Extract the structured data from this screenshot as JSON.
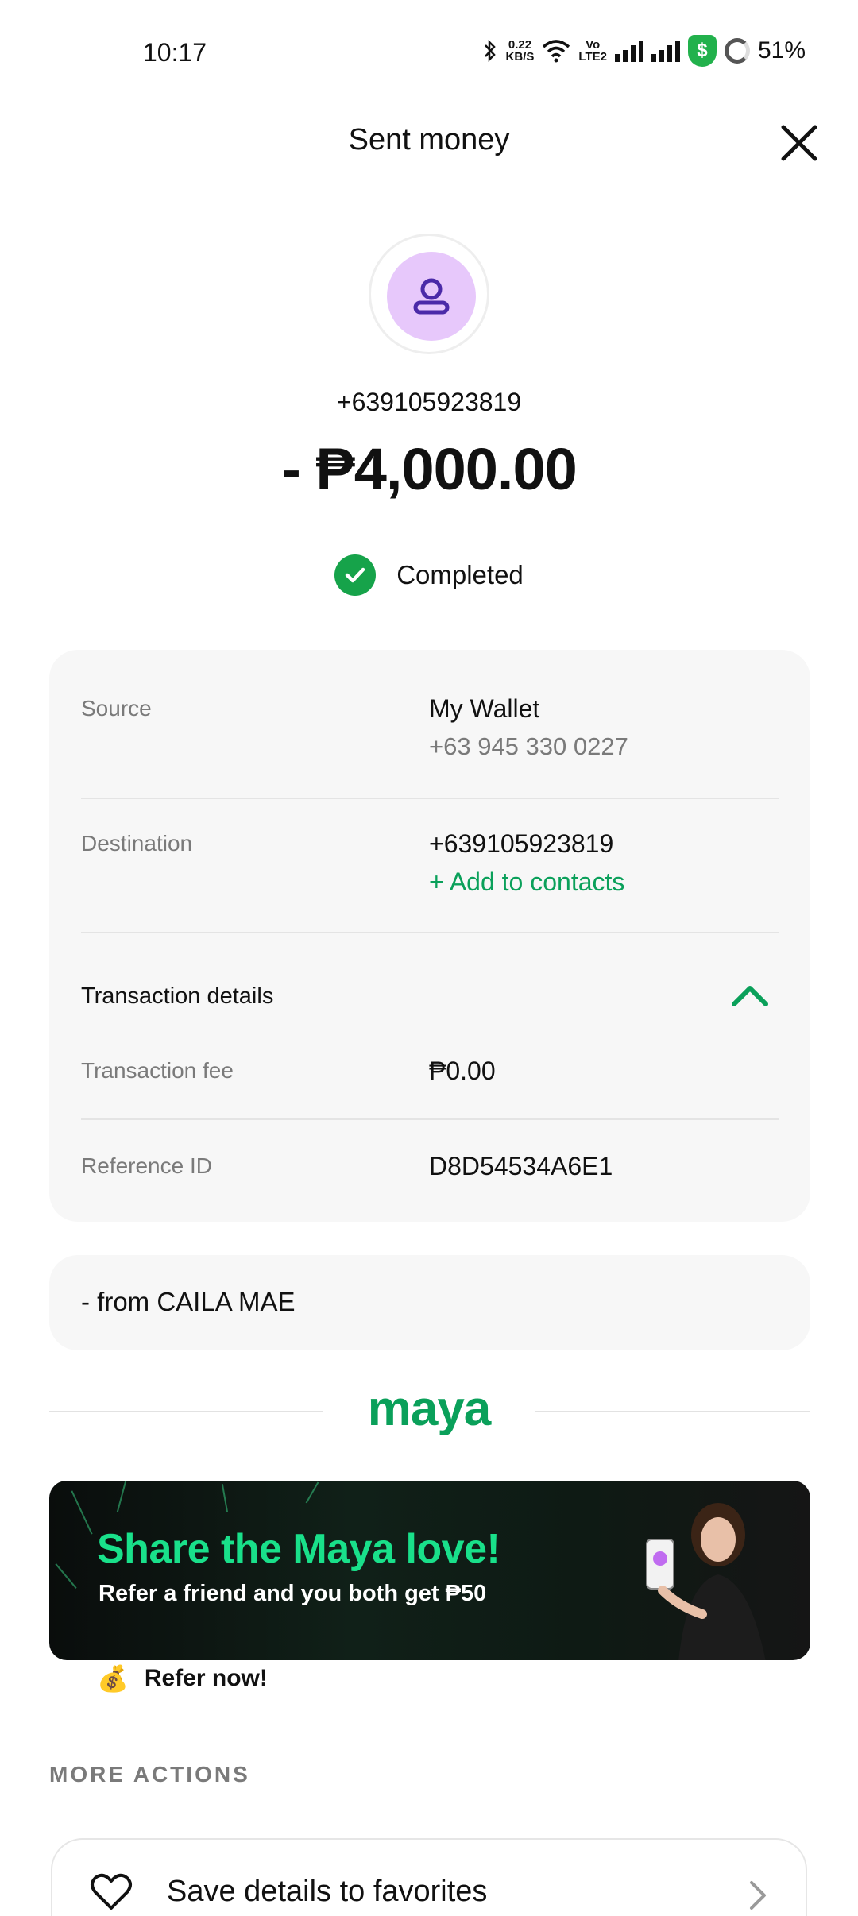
{
  "status_bar": {
    "time": "10:17",
    "speed_value": "0.22",
    "speed_unit": "KB/S",
    "volte_top": "Vo",
    "volte_bottom": "LTE2",
    "battery": "51%",
    "icons": [
      "bluetooth-icon",
      "wifi-icon",
      "volte-icon",
      "signal-icon",
      "signal-icon",
      "security-shield-icon",
      "battery-ring-icon"
    ],
    "shield_symbol": "$"
  },
  "header": {
    "title": "Sent money",
    "close_icon": "close-icon"
  },
  "recipient": {
    "number": "+639105923819",
    "amount": "- ₱4,000.00",
    "avatar_icon": "person-icon"
  },
  "status": {
    "label": "Completed",
    "icon": "check-circle-icon",
    "color": "#16a34a"
  },
  "details": {
    "source_label": "Source",
    "source_value": "My Wallet",
    "source_sub": "+63 945 330 0227",
    "destination_label": "Destination",
    "destination_value": "+639105923819",
    "add_contact": "+ Add to contacts",
    "section_title": "Transaction details",
    "fee_label": "Transaction fee",
    "fee_value": "₱0.00",
    "ref_label": "Reference ID",
    "ref_value": "D8D54534A6E1"
  },
  "note": {
    "text": "- from CAILA MAE"
  },
  "brand": {
    "logo": "maya",
    "color": "#0aa05a"
  },
  "banner": {
    "title": "Share the Maya love!",
    "subtitle": "Refer a friend and you both get ₱50"
  },
  "refer": {
    "icon": "💰",
    "label": "Refer now!"
  },
  "more_actions": {
    "heading": "MORE ACTIONS",
    "items": [
      {
        "label": "Save details to favorites",
        "icon": "heart-icon"
      }
    ]
  }
}
